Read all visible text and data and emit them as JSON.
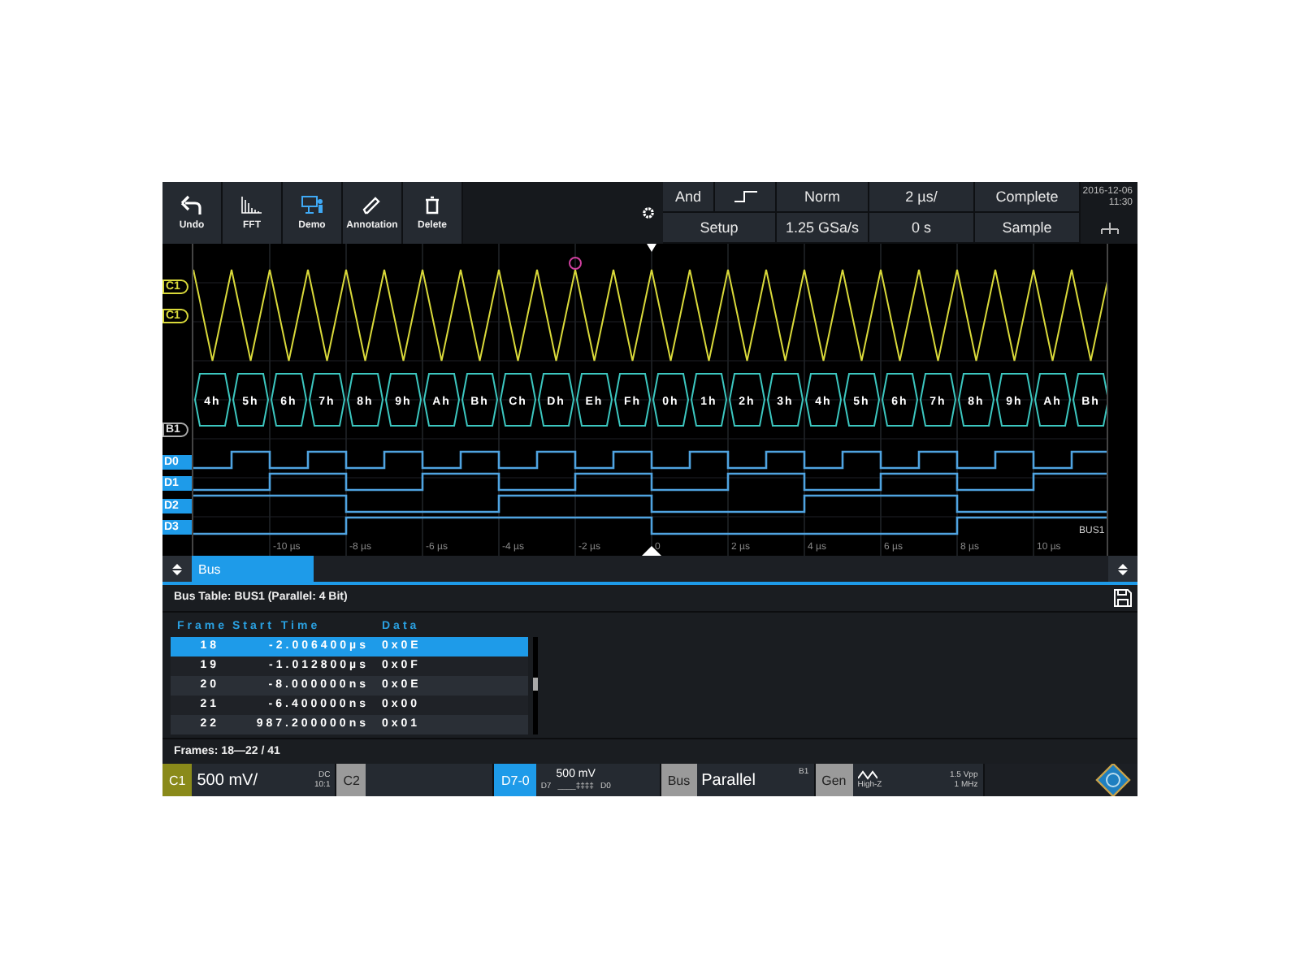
{
  "toolbar": {
    "tools": [
      {
        "label": "Undo",
        "kind": "undo"
      },
      {
        "label": "FFT",
        "kind": "fft"
      },
      {
        "label": "Demo",
        "kind": "demo"
      },
      {
        "label": "Annotation",
        "kind": "annotation"
      },
      {
        "label": "Delete",
        "kind": "delete"
      }
    ]
  },
  "acquisition": {
    "trigger_logic": "And",
    "trigger_mode": "Norm",
    "timebase": "2 µs/",
    "state": "Complete",
    "setup": "Setup",
    "sample_rate": "1.25 GSa/s",
    "position": "0 s",
    "mode": "Sample",
    "date": "2016-12-06",
    "time": "11:30"
  },
  "waveform": {
    "trace_labels": [
      {
        "label": "C1",
        "kind": "trigger"
      },
      {
        "label": "C1",
        "kind": "analog"
      },
      {
        "label": "B1",
        "kind": "bus"
      },
      {
        "label": "D0",
        "kind": "digital"
      },
      {
        "label": "D1",
        "kind": "digital"
      },
      {
        "label": "D2",
        "kind": "digital"
      },
      {
        "label": "D3",
        "kind": "digital"
      }
    ],
    "bus_values": [
      "4h",
      "5h",
      "6h",
      "7h",
      "8h",
      "9h",
      "Ah",
      "Bh",
      "Ch",
      "Dh",
      "Eh",
      "Fh",
      "0h",
      "1h",
      "2h",
      "3h",
      "4h",
      "5h",
      "6h",
      "7h",
      "8h",
      "9h",
      "Ah",
      "Bh"
    ],
    "time_labels": [
      "-10 µs",
      "-8 µs",
      "-6 µs",
      "-4 µs",
      "-2 µs",
      "0",
      "2 µs",
      "4 µs",
      "6 µs",
      "8 µs",
      "10 µs"
    ],
    "bus_name": "BUS1"
  },
  "dock_tabs": [
    {
      "label": "Bus",
      "selected": true
    }
  ],
  "bus_table": {
    "title": "Bus Table: BUS1 (Parallel: 4 Bit)",
    "columns": [
      "Frame",
      "Start Time",
      "Data"
    ],
    "rows": [
      {
        "frame": "18",
        "start_time": "-2.006400µs",
        "data": "0x0E",
        "selected": true
      },
      {
        "frame": "19",
        "start_time": "-1.012800µs",
        "data": "0x0F",
        "selected": false
      },
      {
        "frame": "20",
        "start_time": "-8.000000ns",
        "data": "0x0E",
        "selected": false
      },
      {
        "frame": "21",
        "start_time": "-6.400000ns",
        "data": "0x00",
        "selected": false
      },
      {
        "frame": "22",
        "start_time": "987.200000ns",
        "data": "0x01",
        "selected": false
      }
    ],
    "footer": "Frames: 18—22 / 41"
  },
  "status_bar": {
    "channel": {
      "tag": "C1",
      "scale": "500 mV/",
      "coupling": "DC",
      "probe": "10:1"
    },
    "channel2": {
      "tag": "C2"
    },
    "digital": {
      "tag": "D7-0",
      "threshold": "500 mV",
      "msb": "D7",
      "bits": "____‡‡‡‡",
      "lsb": "D0"
    },
    "bus": {
      "tag": "Bus",
      "protocol": "Parallel",
      "name": "B1"
    },
    "generator": {
      "tag": "Gen",
      "impedance": "High-Z",
      "amplitude": "1.5 Vpp",
      "frequency": "1 MHz"
    }
  }
}
